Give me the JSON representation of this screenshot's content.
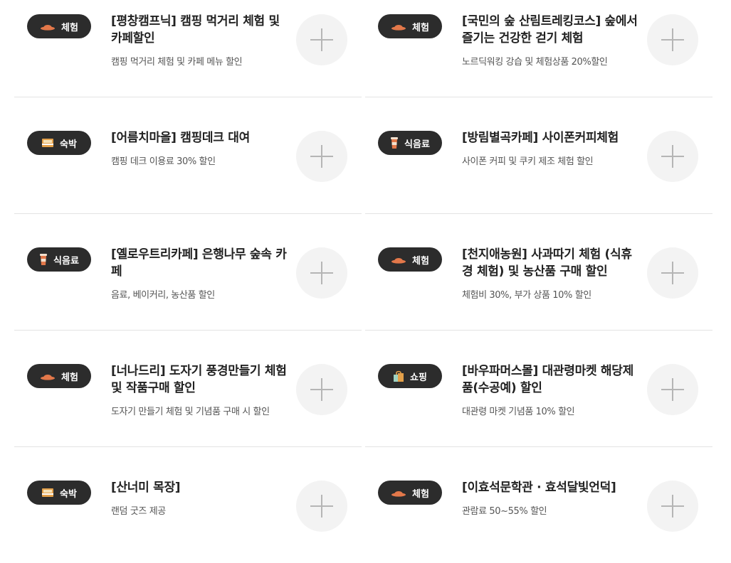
{
  "colors": {
    "badge_bg": "#2c2c2c",
    "divider": "#e3e3e3",
    "add_bg": "#f3f3f3",
    "plus": "#b5b5b5"
  },
  "items": [
    {
      "category": "체험",
      "icon": "hat-icon",
      "title": "[평창캠프닉] 캠핑 먹거리 체험 및 카페할인",
      "desc": "캠핑 먹거리 체험 및 카페 메뉴 할인"
    },
    {
      "category": "체험",
      "icon": "hat-icon",
      "title": "[국민의 숲 산림트레킹코스] 숲에서 즐기는 건강한 걷기 체험",
      "desc": "노르딕워킹 강습 및 체험상품 20%할인"
    },
    {
      "category": "숙박",
      "icon": "bed-icon",
      "title": "[어름치마을] 캠핑데크 대여",
      "desc": "캠핑 데크 이용료 30% 할인"
    },
    {
      "category": "식음료",
      "icon": "cup-icon",
      "title": "[방림별곡카페] 사이폰커피체험",
      "desc": "사이폰 커피 및 쿠키 제조 체험 할인"
    },
    {
      "category": "식음료",
      "icon": "cup-icon",
      "title": "[옐로우트리카페] 은행나무 숲속 카페",
      "desc": "음료, 베이커리, 농산품 할인"
    },
    {
      "category": "체험",
      "icon": "hat-icon",
      "title": "[천지애농원] 사과따기 체험 (식휴경 체험) 및 농산품 구매 할인",
      "desc": "체험비 30%, 부가 상품 10% 할인"
    },
    {
      "category": "체험",
      "icon": "hat-icon",
      "title": "[너나드리] 도자기 풍경만들기 체험 및 작품구매 할인",
      "desc": "도자기 만들기 체험 및 기념품 구매 시 할인"
    },
    {
      "category": "쇼핑",
      "icon": "shopping-bag-icon",
      "title": "[바우파머스몰] 대관령마켓 해당제품(수공예) 할인",
      "desc": "대관령 마켓 기념품 10% 할인"
    },
    {
      "category": "숙박",
      "icon": "bed-icon",
      "title": "[산너미 목장]",
      "desc": "랜덤 굿즈 제공"
    },
    {
      "category": "체험",
      "icon": "hat-icon",
      "title": "[이효석문학관 · 효석달빛언덕]",
      "desc": "관람료 50~55% 할인"
    }
  ]
}
